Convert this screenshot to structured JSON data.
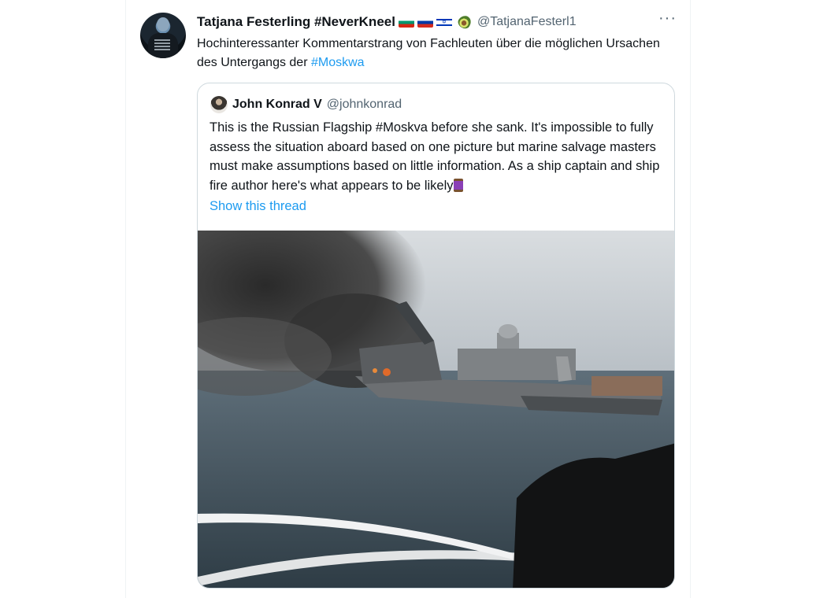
{
  "tweet": {
    "author_name": "Tatjana Festerling #NeverKneel",
    "author_handle": "@TatjanaFesterl1",
    "more_label": "···",
    "text_main": "Hochinteressanter Kommentarstrang von Fachleuten über die möglichen Ursachen des Untergangs der ",
    "hashtag": "#Moskwa",
    "icons": [
      "flag-bulgaria-icon",
      "flag-russia-icon",
      "flag-israel-icon",
      "avocado-icon",
      "more-icon"
    ]
  },
  "quote": {
    "author_name": "John Konrad V",
    "author_handle": "@johnkonrad",
    "text": "This is the Russian Flagship #Moskva before she sank.  It's impossible to fully assess the situation aboard based on one picture but marine salvage masters must make assumptions based on little information. As a ship captain and ship fire author here's what appears to be likely",
    "show_thread_label": "Show this thread",
    "icons": [
      "thread-icon",
      "photo-burning-ship"
    ]
  }
}
